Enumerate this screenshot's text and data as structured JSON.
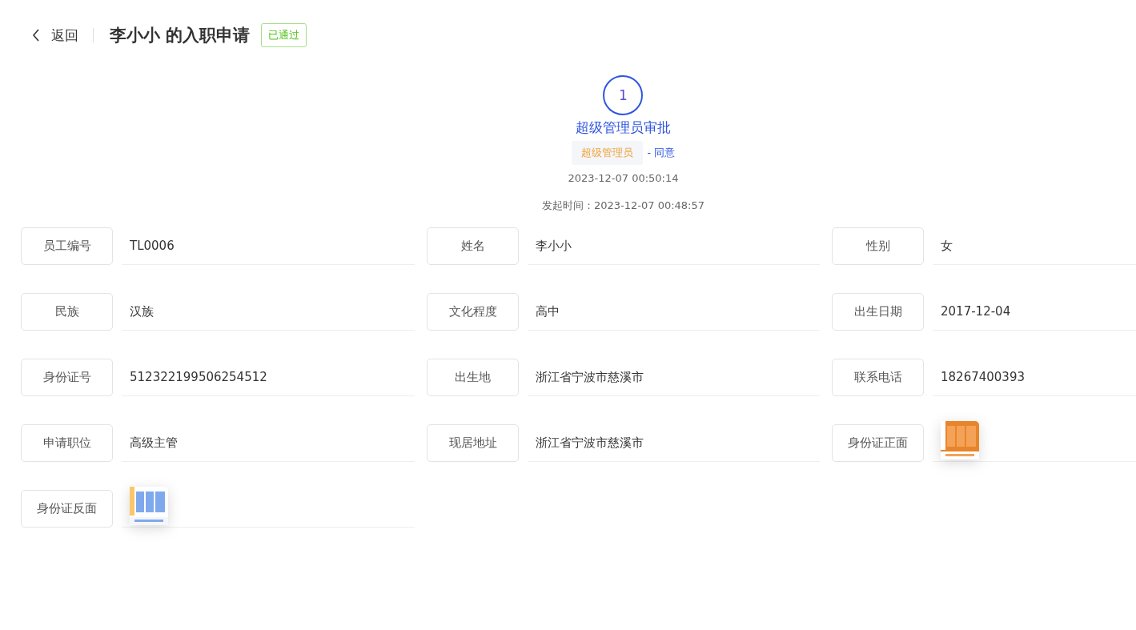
{
  "header": {
    "back_label": "返回",
    "title": "李小小 的入职申请",
    "status_badge": "已通过"
  },
  "approval": {
    "steps": [
      {
        "number": "1",
        "title": "超级管理员审批",
        "approver": "超级管理员",
        "result": "- 同意",
        "time": "2023-12-07 00:50:14"
      }
    ],
    "start_time": "发起时间：2023-12-07 00:48:57"
  },
  "fields": [
    {
      "label": "员工编号",
      "kind": "text",
      "value": "TL0006"
    },
    {
      "label": "姓名",
      "kind": "text",
      "value": "李小小"
    },
    {
      "label": "性别",
      "kind": "text",
      "value": "女"
    },
    {
      "label": "民族",
      "kind": "text",
      "value": "汉族"
    },
    {
      "label": "文化程度",
      "kind": "text",
      "value": "高中"
    },
    {
      "label": "出生日期",
      "kind": "text",
      "value": "2017-12-04"
    },
    {
      "label": "身份证号",
      "kind": "text",
      "value": "512322199506254512"
    },
    {
      "label": "出生地",
      "kind": "text",
      "value": "浙江省宁波市慈溪市"
    },
    {
      "label": "联系电话",
      "kind": "text",
      "value": "18267400393"
    },
    {
      "label": "申请职位",
      "kind": "text",
      "value": "高级主管"
    },
    {
      "label": "现居地址",
      "kind": "text",
      "value": "浙江省宁波市慈溪市"
    },
    {
      "label": "身份证正面"
    },
    {
      "label": "身份证反面"
    }
  ]
}
